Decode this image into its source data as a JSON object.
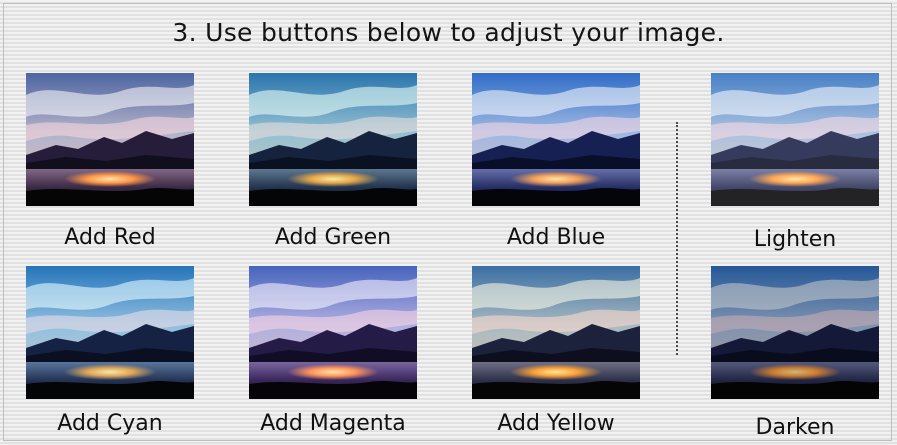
{
  "instruction": "3. Use buttons below to adjust your image.",
  "color_buttons": [
    {
      "label": "Add Red",
      "tint": "#ff6a4a",
      "strength": 0.18
    },
    {
      "label": "Add Green",
      "tint": "#3fd27a",
      "strength": 0.14
    },
    {
      "label": "Add Blue",
      "tint": "#4a6cff",
      "strength": 0.14
    },
    {
      "label": "Add Cyan",
      "tint": "#35d6e6",
      "strength": 0.15
    },
    {
      "label": "Add Magenta",
      "tint": "#e24bd1",
      "strength": 0.16
    },
    {
      "label": "Add Yellow",
      "tint": "#ffe04a",
      "strength": 0.14
    }
  ],
  "brightness_buttons": [
    {
      "label": "Lighten",
      "tint": "#ffffff",
      "strength": 0.12
    },
    {
      "label": "Darken",
      "tint": "#000000",
      "strength": 0.2
    }
  ],
  "colors": {
    "sky_top": "#2f6fbf",
    "sky_bottom": "#f0c6b7",
    "mountain": "#1a2046",
    "water": "#2a2f56",
    "sunset": "#ff9b3d"
  }
}
